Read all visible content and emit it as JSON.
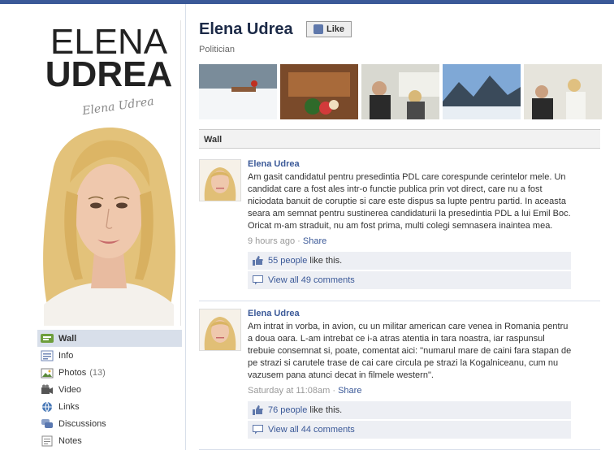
{
  "profile": {
    "name": "Elena Udrea",
    "category": "Politician",
    "like_label": "Like",
    "picture_title_line1": "ELENA",
    "picture_title_line2": "UDREA",
    "picture_signature": "Elena Udrea"
  },
  "nav": {
    "items": [
      {
        "label": "Wall",
        "icon": "wall-icon",
        "active": true
      },
      {
        "label": "Info",
        "icon": "info-icon"
      },
      {
        "label": "Photos",
        "icon": "photos-icon",
        "count": "(13)"
      },
      {
        "label": "Video",
        "icon": "video-icon"
      },
      {
        "label": "Links",
        "icon": "links-icon"
      },
      {
        "label": "Discussions",
        "icon": "discussions-icon"
      },
      {
        "label": "Notes",
        "icon": "notes-icon"
      }
    ]
  },
  "wall_tab": "Wall",
  "posts": [
    {
      "author": "Elena Udrea",
      "text": "Am gasit candidatul pentru presedintia PDL care corespunde cerintelor mele. Un candidat care a fost ales intr-o functie publica prin vot direct, care nu a fost niciodata banuit de coruptie si care este dispus sa lupte pentru partid. In aceasta seara am semnat pentru sustinerea candidaturii la presedintia PDL a lui Emil Boc. Oricat m-am straduit, nu am fost prima, multi colegi semnasera inaintea mea.",
      "time": "9 hours ago",
      "share": "Share",
      "likes_link": "55 people",
      "likes_suffix": "like this.",
      "comments_link": "View all 49 comments"
    },
    {
      "author": "Elena Udrea",
      "text": "Am intrat in vorba, in avion, cu un militar american care venea in Romania pentru a doua oara. L-am intrebat ce i-a atras atentia in tara noastra, iar raspunsul trebuie consemnat si, poate, comentat aici: \"numarul mare de caini fara stapan de pe strazi si carutele trase de cai care circula pe strazi la Kogalniceanu, cum nu vazusem pana atunci decat in filmele western\".",
      "time": "Saturday at 11:08am",
      "share": "Share",
      "likes_link": "76 people",
      "likes_suffix": "like this.",
      "comments_link": "View all 44 comments"
    }
  ],
  "colors": {
    "brand": "#3b5998",
    "nav_active": "#d8dfea",
    "ufi_bg": "#edeff4"
  }
}
